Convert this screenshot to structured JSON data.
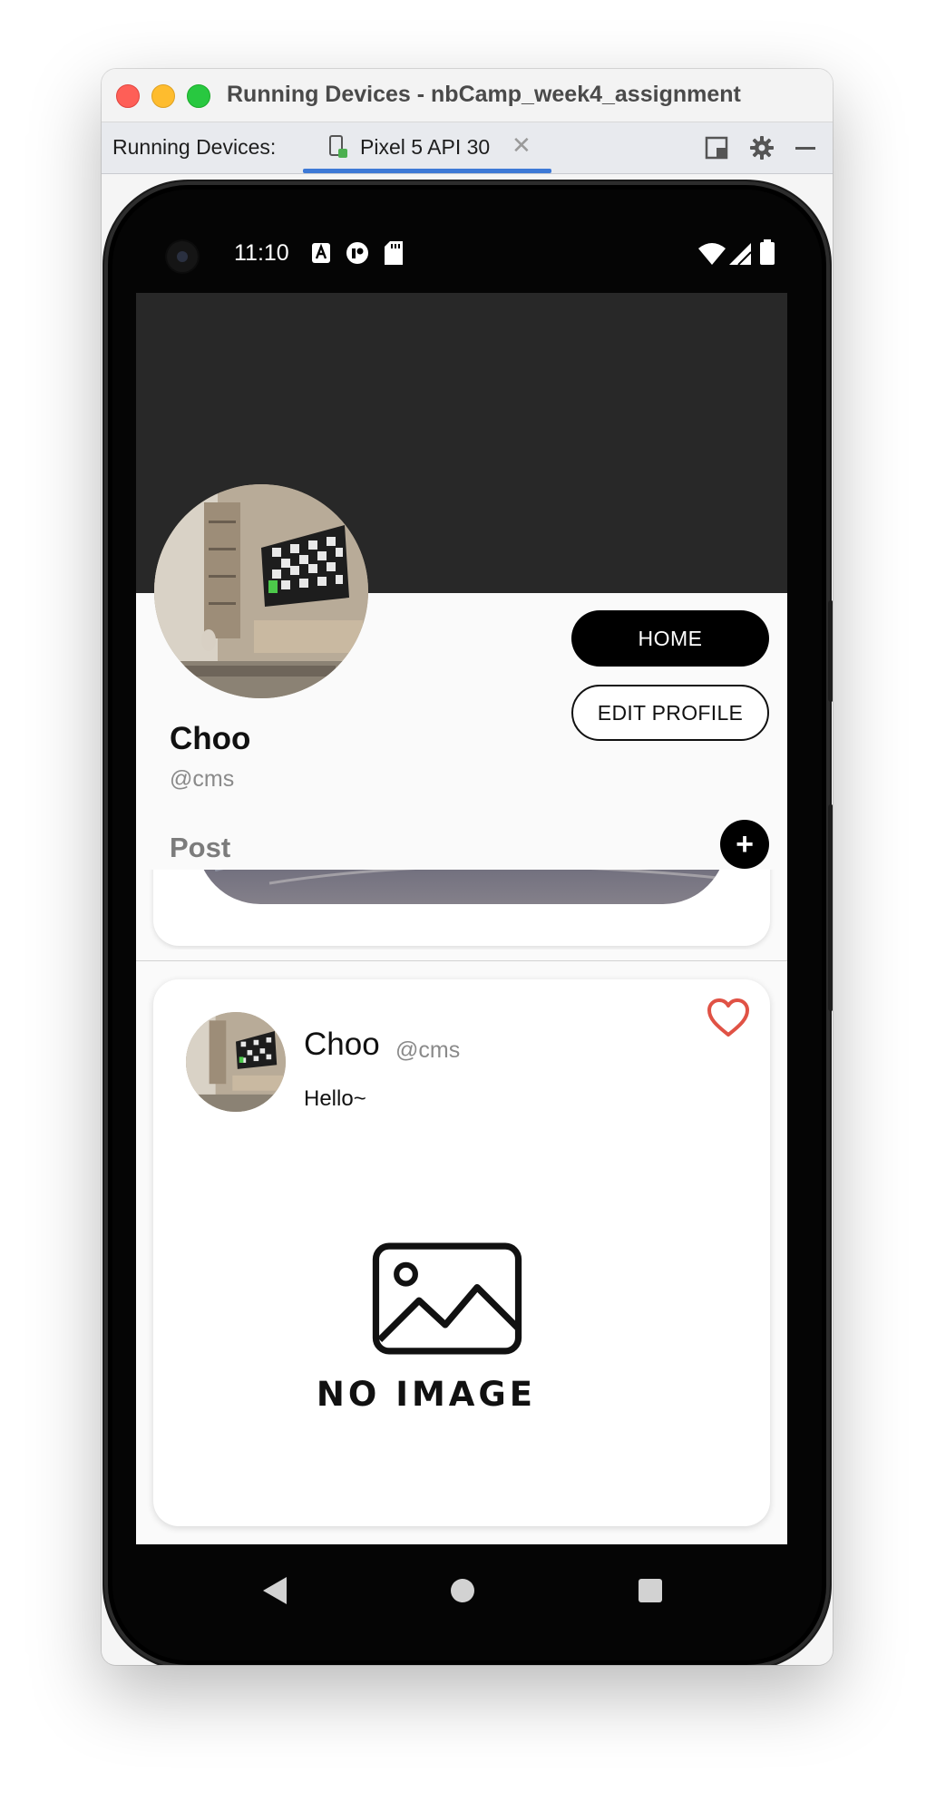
{
  "window": {
    "title": "Running Devices - nbCamp_week4_assignment"
  },
  "toolbar": {
    "label": "Running Devices:",
    "tab_label": "Pixel 5 API 30",
    "close_glyph": "✕",
    "icons": [
      "split-layout-icon",
      "gear-icon",
      "minimize-icon"
    ]
  },
  "status_bar": {
    "time": "11:10",
    "left_icons": [
      "a-notification-icon",
      "app-notification-icon",
      "sd-card-icon"
    ],
    "right_icons": [
      "wifi-icon",
      "signal-icon",
      "battery-icon"
    ]
  },
  "profile": {
    "name": "Choo",
    "handle": "@cms",
    "home_button": "HOME",
    "edit_button": "EDIT PROFILE",
    "post_label": "Post",
    "add_button": "+"
  },
  "post": {
    "name": "Choo",
    "handle": "@cms",
    "text": "Hello~",
    "no_image_text": "NO IMAGE",
    "liked": true,
    "heart_color": "#e05245"
  },
  "nav_bar": {
    "icons": [
      "back-icon",
      "home-icon",
      "recents-icon"
    ]
  },
  "colors": {
    "header_dark": "#282828",
    "accent_blue": "#3d79d6"
  }
}
